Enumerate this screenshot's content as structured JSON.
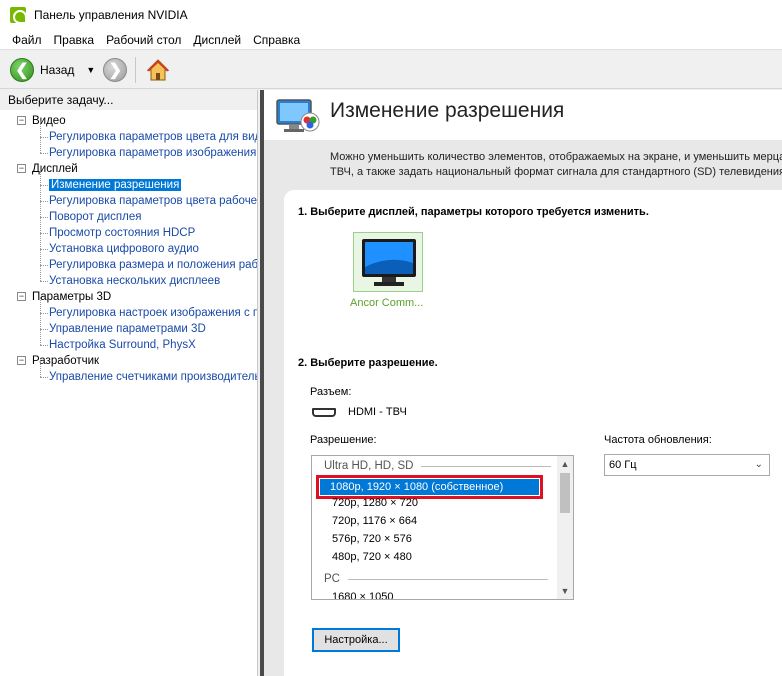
{
  "window": {
    "title": "Панель управления NVIDIA"
  },
  "menu": {
    "items": [
      "Файл",
      "Правка",
      "Рабочий стол",
      "Дисплей",
      "Справка"
    ]
  },
  "toolbar": {
    "back_label": "Назад"
  },
  "sidebar": {
    "header": "Выберите задачу...",
    "categories": [
      {
        "label": "Видео",
        "toggle": "⊟",
        "items": [
          "Регулировка параметров цвета для вид",
          "Регулировка параметров изображения д"
        ]
      },
      {
        "label": "Дисплей",
        "toggle": "⊟",
        "items": [
          "Изменение разрешения",
          "Регулировка параметров цвета рабочег",
          "Поворот дисплея",
          "Просмотр состояния HDCP",
          "Установка цифрового аудио",
          "Регулировка размера и положения рабо",
          "Установка нескольких дисплеев"
        ]
      },
      {
        "label": "Параметры 3D",
        "toggle": "⊟",
        "items": [
          "Регулировка настроек изображения с пр",
          "Управление параметрами 3D",
          "Настройка Surround, PhysX"
        ]
      },
      {
        "label": "Разработчик",
        "toggle": "⊟",
        "items": [
          "Управление счетчиками производителы"
        ]
      }
    ],
    "selected": "Изменение разрешения"
  },
  "main": {
    "title": "Изменение разрешения",
    "description": [
      "Можно уменьшить количество элементов, отображаемых на экране, и уменьшить мерца",
      "ТВЧ, а также задать национальный формат сигнала для стандартного (SD) телевидения"
    ],
    "step1": "1. Выберите дисплей, параметры которого требуется изменить.",
    "display_name": "Ancor Comm...",
    "step2": "2. Выберите разрешение.",
    "connector_label": "Разъем:",
    "connector_value": "HDMI - ТВЧ",
    "resolution_label": "Разрешение:",
    "refresh_label": "Частота обновления:",
    "refresh_value": "60 Гц",
    "resolution_groups": [
      {
        "name": "Ultra HD, HD, SD",
        "items": [
          "1080p, 1920 × 1080 (собственное)",
          "720p, 1280 × 720",
          "720p, 1176 × 664",
          "576p, 720 × 576",
          "480p, 720 × 480"
        ]
      },
      {
        "name": "PC",
        "items": [
          "1680 × 1050"
        ]
      }
    ],
    "selected_resolution": "1080p, 1920 × 1080 (собственное)",
    "settings_button": "Настройка..."
  },
  "colors": {
    "accent": "#0078d7",
    "highlight_border": "#e01020",
    "nvidia_green": "#76b900"
  }
}
